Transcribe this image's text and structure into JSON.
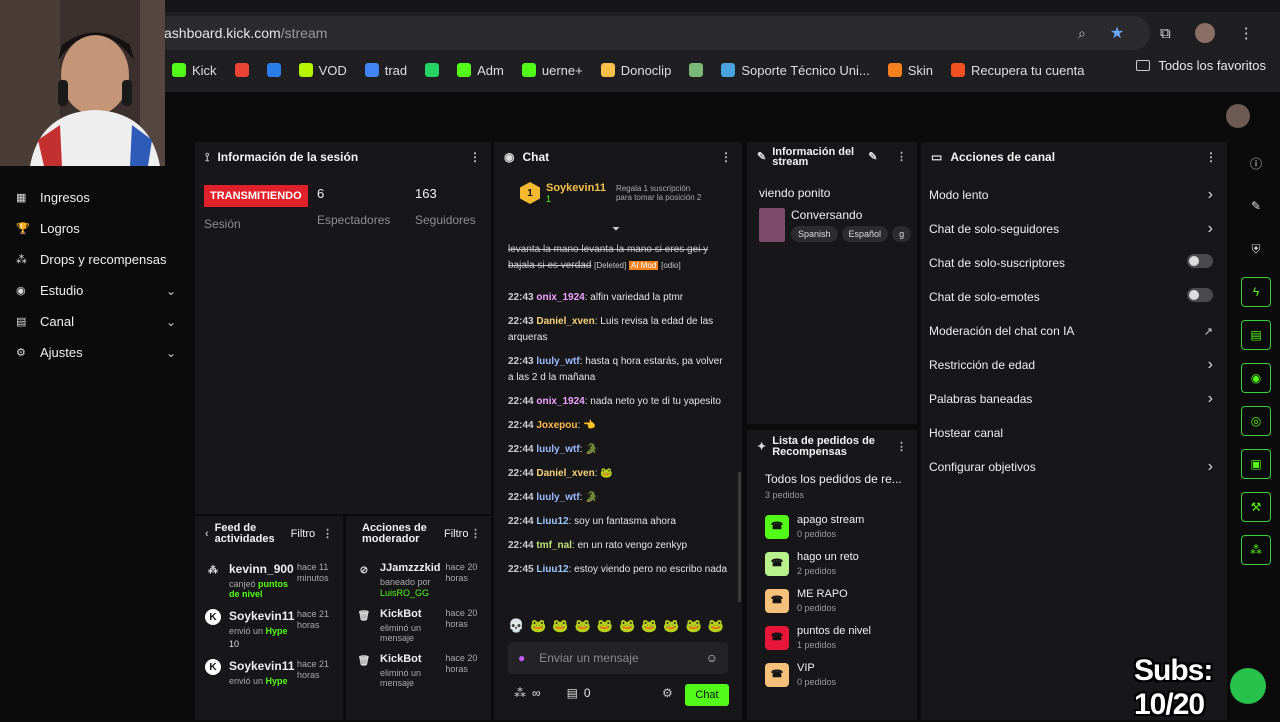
{
  "browser": {
    "url_host": "ashboard.kick.com",
    "url_path": "/stream",
    "bookmarks": [
      {
        "label": "Kick",
        "color": "#53fc18"
      },
      {
        "label": "",
        "color": "#ea4335"
      },
      {
        "label": "",
        "color": "#2b7de9"
      },
      {
        "label": "VOD",
        "color": "#b7f500"
      },
      {
        "label": "trad",
        "color": "#4285f4"
      },
      {
        "label": "",
        "color": "#25d366"
      },
      {
        "label": "Adm",
        "color": "#53fc18"
      },
      {
        "label": "uerne+",
        "color": "#53fc18"
      },
      {
        "label": "Donoclip",
        "color": "#f5c04a"
      },
      {
        "label": "",
        "color": "#7ab87a"
      },
      {
        "label": "Soporte Técnico Uni...",
        "color": "#4aa3df"
      },
      {
        "label": "Skin",
        "color": "#f5821f"
      },
      {
        "label": "Recupera tu cuenta",
        "color": "#f25022"
      }
    ],
    "all_favorites": "Todos los favoritos"
  },
  "sidebar": {
    "items": [
      {
        "label": "Ingresos",
        "chevron": false
      },
      {
        "label": "Logros",
        "chevron": false
      },
      {
        "label": "Drops y recompensas",
        "chevron": false
      },
      {
        "label": "Estudio",
        "chevron": true
      },
      {
        "label": "Canal",
        "chevron": true
      },
      {
        "label": "Ajustes",
        "chevron": true
      }
    ]
  },
  "session": {
    "title": "Información de la sesión",
    "badge": "TRANSMITIENDO",
    "session_label": "Sesión",
    "viewers": "6",
    "viewers_label": "Espectadores",
    "followers": "163",
    "followers_label": "Seguidores"
  },
  "chat": {
    "title": "Chat",
    "pinned_user": "Soykevin11",
    "pinned_sub": "1",
    "pinned_note": "Regala 1 suscripción para tomar la posición 2",
    "deleted_text": "levanta la mano levanta la mano si eres gei y bajala si es verdad",
    "deleted_tag": "[Deleted]",
    "ai_tag": "AI Mod",
    "odio_tag": "[odio]",
    "messages": [
      {
        "time": "22:43",
        "user": "onix_1924",
        "color": "#f2a3ff",
        "text": ": alfin variedad la ptmr"
      },
      {
        "time": "22:43",
        "user": "Daniel_xven",
        "color": "#f7d27a",
        "text": ": Luis revisa la edad de las arqueras"
      },
      {
        "time": "22:43",
        "user": "luuly_wtf",
        "color": "#9db8ff",
        "text": ": hasta q hora estarás, pa volver a las 2 d la mañana"
      },
      {
        "time": "22:44",
        "user": "onix_1924",
        "color": "#f2a3ff",
        "text": ": nada neto yo te di tu yapesito"
      },
      {
        "time": "22:44",
        "user": "Joxepou",
        "color": "#ffb84d",
        "text": ": 👈"
      },
      {
        "time": "22:44",
        "user": "luuly_wtf",
        "color": "#9db8ff",
        "text": ": 🐊"
      },
      {
        "time": "22:44",
        "user": "Daniel_xven",
        "color": "#f7d27a",
        "text": ": 🐸"
      },
      {
        "time": "22:44",
        "user": "luuly_wtf",
        "color": "#9db8ff",
        "text": ": 🐊"
      },
      {
        "time": "22:44",
        "user": "Liuu12",
        "color": "#9ec8ff",
        "text": ": soy un fantasma ahora"
      },
      {
        "time": "22:44",
        "user": "tmf_nal",
        "color": "#bfe37a",
        "text": ": en un rato vengo zenkyp"
      },
      {
        "time": "22:45",
        "user": "Liuu12",
        "color": "#9ec8ff",
        "text": ": estoy viendo pero no escribo nada"
      }
    ],
    "input_placeholder": "Enviar un mensaje",
    "send_label": "Chat",
    "count_a": "∞",
    "count_b": "0"
  },
  "stream_info": {
    "title": "Información del stream",
    "stream_title": "viendo ponito",
    "category": "Conversando",
    "tags": [
      "Spanish",
      "Español",
      "g"
    ]
  },
  "rewards": {
    "title": "Lista de pedidos de Recompensas",
    "all_label": "Todos los pedidos de re...",
    "all_count": "3 pedidos",
    "items": [
      {
        "name": "apago stream",
        "count": "0 pedidos",
        "color": "#53fc18"
      },
      {
        "name": "hago un reto",
        "count": "2 pedidos",
        "color": "#b7f28c"
      },
      {
        "name": "ME RAPO",
        "count": "0 pedidos",
        "color": "#f5c07a"
      },
      {
        "name": "puntos de nivel",
        "count": "1 pedidos",
        "color": "#e8173a"
      },
      {
        "name": "VIP",
        "count": "0 pedidos",
        "color": "#f5c07a"
      }
    ]
  },
  "channel_actions": {
    "title": "Acciones de canal",
    "rows": [
      {
        "label": "Modo lento",
        "right": "chevron"
      },
      {
        "label": "Chat de solo-seguidores",
        "right": "chevron"
      },
      {
        "label": "Chat de solo-suscriptores",
        "right": "toggle"
      },
      {
        "label": "Chat de solo-emotes",
        "right": "toggle"
      },
      {
        "label": "Moderación del chat con IA",
        "right": "external"
      },
      {
        "label": "Restricción de edad",
        "right": "chevron"
      },
      {
        "label": "Palabras baneadas",
        "right": "chevron"
      },
      {
        "label": "Hostear canal",
        "right": "none"
      },
      {
        "label": "Configurar objetivos",
        "right": "chevron"
      }
    ]
  },
  "activity_feed": {
    "title": "Feed de actividades",
    "filter": "Filtro",
    "items": [
      {
        "user": "kevinn_900",
        "time": "hace 11 minutos",
        "action": "canjeó",
        "highlight": "puntos de nivel",
        "extra": ""
      },
      {
        "user": "Soykevin11",
        "time": "hace 21 horas",
        "action": "envió un",
        "highlight": "Hype",
        "extra": "10"
      },
      {
        "user": "Soykevin11",
        "time": "hace 21 horas",
        "action": "envió un",
        "highlight": "Hype",
        "extra": ""
      }
    ]
  },
  "mod_actions": {
    "title": "Acciones de moderador",
    "filter": "Filtro",
    "items": [
      {
        "user": "JJamzzzkid",
        "time": "hace 20 horas",
        "action": "baneado por",
        "by": "LuisRO_GG"
      },
      {
        "user": "KickBot",
        "time": "hace 20 horas",
        "action": "eliminó un mensaje",
        "by": ""
      },
      {
        "user": "KickBot",
        "time": "hace 20 horas",
        "action": "eliminó un mensaje",
        "by": ""
      }
    ]
  },
  "overlay": {
    "subs": "Subs: 10/20"
  },
  "colors": {
    "kick_green": "#53fc18",
    "live_red": "#e0202a"
  }
}
